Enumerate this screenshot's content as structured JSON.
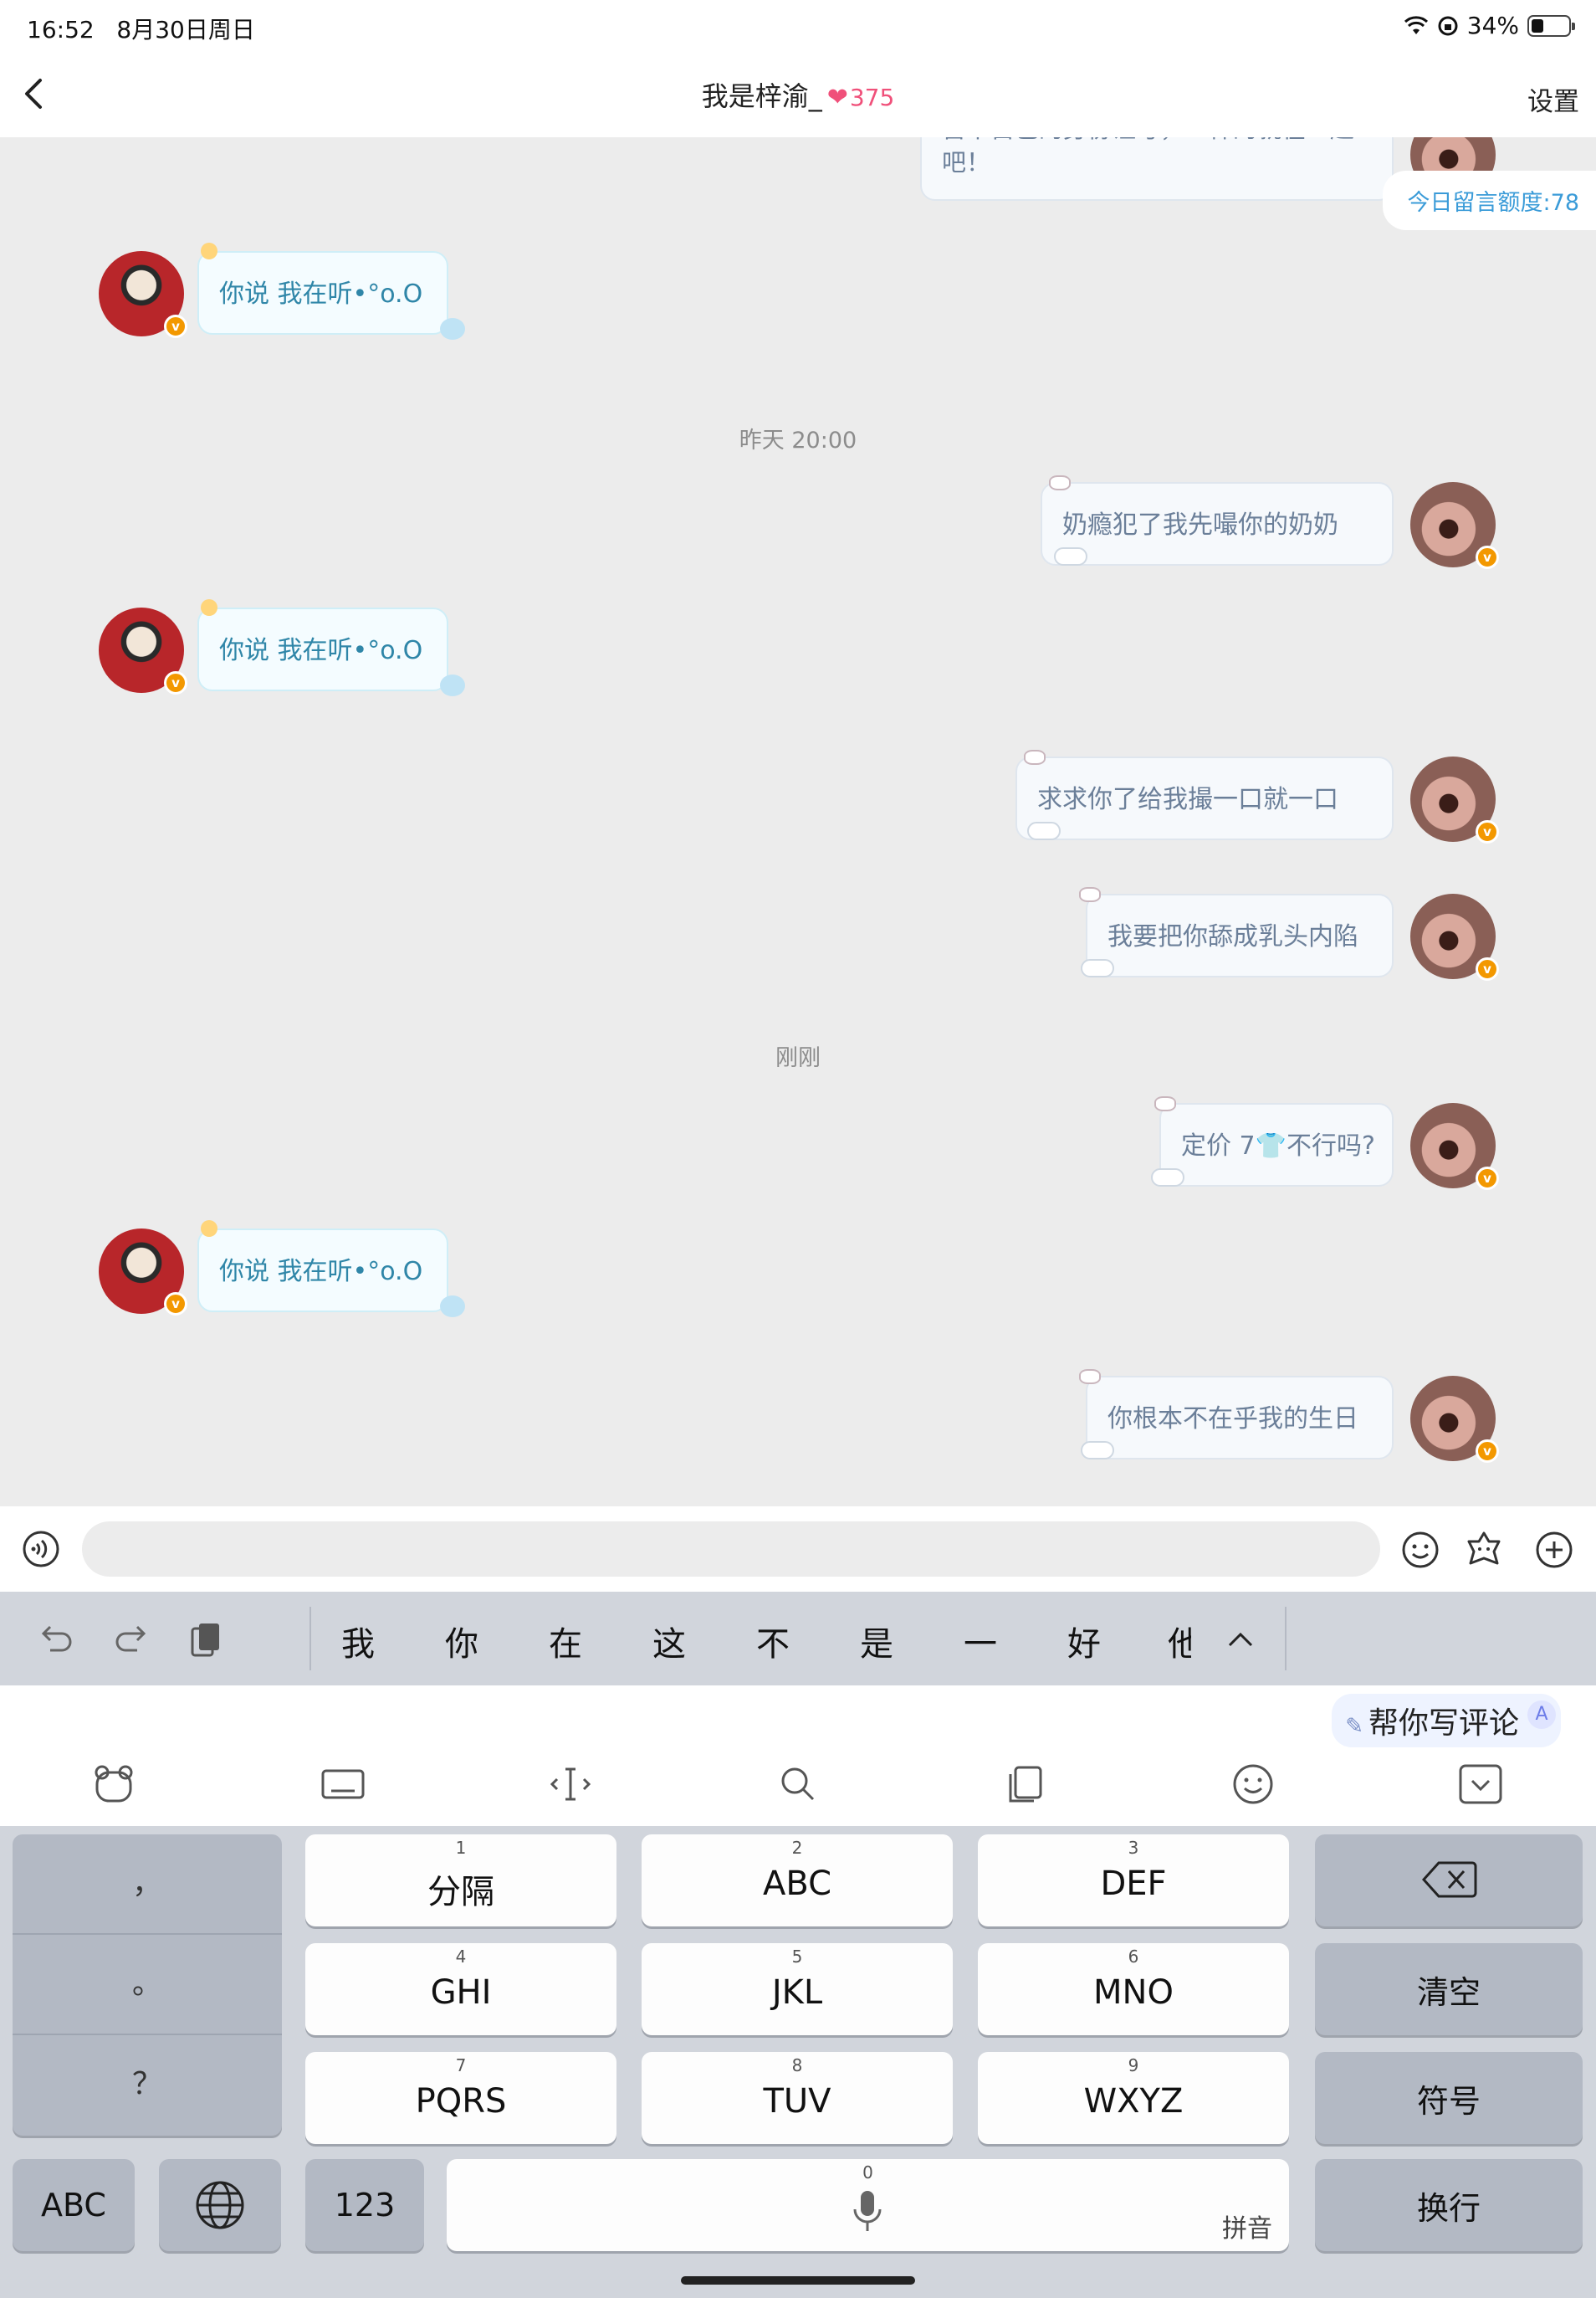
{
  "status_bar": {
    "time": "16:52",
    "date": "8月30日周日",
    "battery_percent": "34%",
    "battery_level": 0.34
  },
  "nav": {
    "title": "我是梓渝_",
    "heart": "❤",
    "fan_count": "375",
    "settings_label": "设置"
  },
  "chat": {
    "quota_label": "今日留言额度:78",
    "top_partial_message": "留下自己的身份证号，一样的就在一起吧！",
    "messages": [
      {
        "side": "left",
        "text": "你说 我在听•°o.O"
      },
      {
        "side": "time",
        "text": "昨天 20:00"
      },
      {
        "side": "right",
        "text": "奶瘾犯了我先嘬你的奶奶"
      },
      {
        "side": "left",
        "text": "你说 我在听•°o.O"
      },
      {
        "side": "right",
        "text": "求求你了给我撮一口就一口"
      },
      {
        "side": "right",
        "text": "我要把你舔成乳头内陷"
      },
      {
        "side": "time",
        "text": "刚刚"
      },
      {
        "side": "right",
        "text": "定价 7👕不行吗?"
      },
      {
        "side": "left",
        "text": "你说 我在听•°o.O"
      },
      {
        "side": "right",
        "text": "你根本不在乎我的生日"
      }
    ]
  },
  "input_bar": {
    "placeholder": "",
    "icons": [
      "voice-icon",
      "emoji-icon",
      "sticker-icon",
      "plus-icon"
    ]
  },
  "keyboard": {
    "candidates": [
      "我",
      "你",
      "在",
      "这",
      "不",
      "是",
      "一",
      "好",
      "他"
    ],
    "ai_write_label": "帮你写评论",
    "ai_badge": "A",
    "punctuation": [
      "，",
      "。",
      "？"
    ],
    "t9_keys": [
      {
        "num": "1",
        "label": "分隔"
      },
      {
        "num": "2",
        "label": "ABC"
      },
      {
        "num": "3",
        "label": "DEF"
      },
      {
        "num": "4",
        "label": "GHI"
      },
      {
        "num": "5",
        "label": "JKL"
      },
      {
        "num": "6",
        "label": "MNO"
      },
      {
        "num": "7",
        "label": "PQRS"
      },
      {
        "num": "8",
        "label": "TUV"
      },
      {
        "num": "9",
        "label": "WXYZ"
      }
    ],
    "side_keys": {
      "clear": "清空",
      "symbols": "符号",
      "enter": "换行"
    },
    "bottom_keys": {
      "abc": "ABC",
      "num123": "123",
      "space_num": "0",
      "space_hint": "拼音"
    }
  }
}
